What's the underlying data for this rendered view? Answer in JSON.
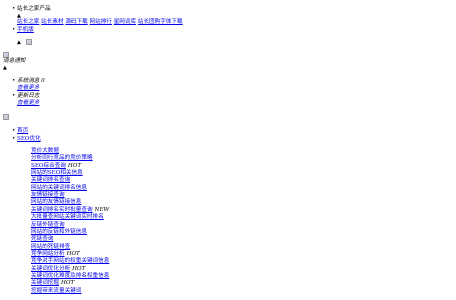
{
  "header": {
    "products_label": "站长之家产品",
    "caret": "▲",
    "links": [
      "站长之家",
      "站长素材",
      "源码下载",
      "网站排行",
      "星网词库",
      "站长团购字体下载"
    ],
    "mobile_label": "手机版",
    "caret2": "▲"
  },
  "messages": {
    "title": "消息通知",
    "caret": "▲",
    "items": [
      {
        "label": "系统消息 0",
        "more": "查看更多"
      },
      {
        "label": "更新日志",
        "more": "查看更多"
      }
    ]
  },
  "nav": {
    "home": "首页",
    "seo": "SEO优化"
  },
  "menu": [
    {
      "label": "竞价大数据",
      "badge": ""
    },
    {
      "label": "分析同行竞品的竞价策略",
      "badge": ""
    },
    {
      "label": "SEO综合查询",
      "badge": "HOT"
    },
    {
      "label": "网站的SEO相关信息",
      "badge": ""
    },
    {
      "label": "关键词排名查询",
      "badge": ""
    },
    {
      "label": "网站的关键词排名信息",
      "badge": ""
    },
    {
      "label": "友情链接查询",
      "badge": ""
    },
    {
      "label": "网站的友情链接信息",
      "badge": ""
    },
    {
      "label": "关键词排名实时批量查询",
      "badge": "NEW"
    },
    {
      "label": "大批量查网站关键词实时排名",
      "badge": ""
    },
    {
      "label": "反链外链查询",
      "badge": ""
    },
    {
      "label": "网站的反链和外链信息",
      "badge": ""
    },
    {
      "label": "死链查询",
      "badge": ""
    },
    {
      "label": "网站的死链排查",
      "badge": ""
    },
    {
      "label": "竞争网站分析",
      "badge": "HOT"
    },
    {
      "label": "竞争对手网站的权重关键词信息",
      "badge": ""
    },
    {
      "label": "关键词优化分析",
      "badge": "HOT"
    },
    {
      "label": "关键词优化难度及排名权重信息",
      "badge": ""
    },
    {
      "label": "关键词挖掘",
      "badge": "HOT"
    },
    {
      "label": "挖掘带来流量关键词",
      "badge": ""
    }
  ]
}
